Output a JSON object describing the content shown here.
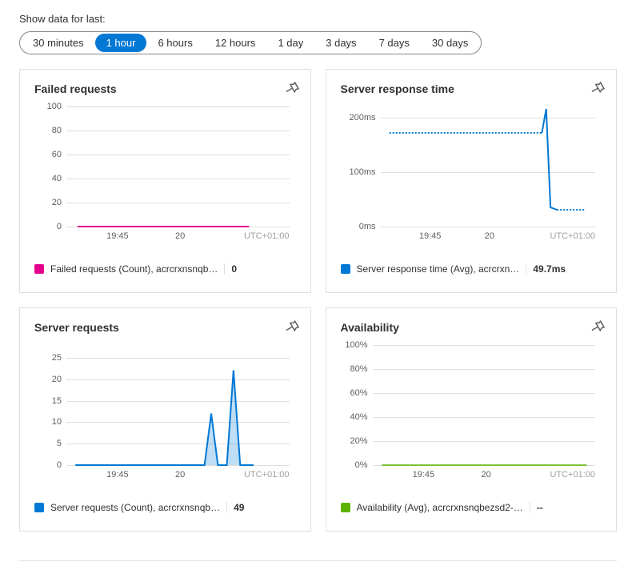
{
  "time_filter": {
    "label": "Show data for last:",
    "options": [
      "30 minutes",
      "1 hour",
      "6 hours",
      "12 hours",
      "1 day",
      "3 days",
      "7 days",
      "30 days"
    ],
    "selected": "1 hour"
  },
  "timezone": "UTC+01:00",
  "x_ticks": [
    "19:45",
    "20"
  ],
  "panels": {
    "failed_requests": {
      "title": "Failed requests",
      "legend_label": "Failed requests (Count), acrcrxnsnqb…",
      "legend_value": "0",
      "legend_color": "#e3008c",
      "y_ticks": [
        "100",
        "80",
        "60",
        "40",
        "20",
        "0"
      ]
    },
    "server_response_time": {
      "title": "Server response time",
      "legend_label": "Server response time (Avg), acrcrxn…",
      "legend_value": "49.7ms",
      "legend_color": "#0078d4",
      "y_ticks": [
        "200ms",
        "100ms",
        "0ms"
      ]
    },
    "server_requests": {
      "title": "Server requests",
      "legend_label": "Server requests (Count), acrcrxnsnqb…",
      "legend_value": "49",
      "legend_color": "#0078d4",
      "y_ticks": [
        "25",
        "20",
        "15",
        "10",
        "5",
        "0"
      ]
    },
    "availability": {
      "title": "Availability",
      "legend_label": "Availability (Avg), acrcrxnsnqbezsd2-…",
      "legend_value": "--",
      "legend_color": "#5db300",
      "y_ticks": [
        "100%",
        "80%",
        "60%",
        "40%",
        "20%",
        "0%"
      ]
    }
  },
  "chart_data": [
    {
      "type": "line",
      "title": "Failed requests",
      "ylabel": "Count",
      "x_range_minutes": 60,
      "x_ticks": [
        "19:45",
        "20"
      ],
      "ylim": [
        0,
        100
      ],
      "series": [
        {
          "name": "Failed requests (Count), acrcrxnsnqb…",
          "color": "#e3008c",
          "x": [
            0,
            5,
            10,
            15,
            20,
            25,
            30,
            35,
            40,
            45,
            50,
            55,
            60
          ],
          "values": [
            0,
            0,
            0,
            0,
            0,
            0,
            0,
            0,
            0,
            0,
            0,
            0,
            0
          ]
        }
      ],
      "legend_summary": 0
    },
    {
      "type": "line",
      "title": "Server response time",
      "ylabel": "ms",
      "x_range_minutes": 60,
      "x_ticks": [
        "19:45",
        "20"
      ],
      "ylim": [
        0,
        220
      ],
      "series": [
        {
          "name": "Server response time (Avg), acrcrxn…",
          "color": "#0078d4",
          "x": [
            0,
            5,
            10,
            15,
            20,
            25,
            30,
            35,
            40,
            45,
            47,
            48,
            50,
            55,
            60
          ],
          "values": [
            170,
            170,
            170,
            170,
            170,
            170,
            170,
            170,
            170,
            170,
            215,
            35,
            30,
            30,
            30
          ],
          "dashed_until_x": 45
        }
      ],
      "legend_summary": "49.7ms"
    },
    {
      "type": "area",
      "title": "Server requests",
      "ylabel": "Count",
      "x_range_minutes": 60,
      "x_ticks": [
        "19:45",
        "20"
      ],
      "ylim": [
        0,
        28
      ],
      "series": [
        {
          "name": "Server requests (Count), acrcrxnsnqb…",
          "color": "#0078d4",
          "x": [
            0,
            5,
            10,
            15,
            20,
            25,
            30,
            35,
            38,
            40,
            42,
            44,
            46,
            48,
            50,
            55,
            60
          ],
          "values": [
            0,
            0,
            0,
            0,
            0,
            0,
            0,
            0,
            0,
            12,
            0,
            0,
            22,
            0,
            0,
            0,
            0
          ]
        }
      ],
      "legend_summary": 49
    },
    {
      "type": "line",
      "title": "Availability",
      "ylabel": "%",
      "x_range_minutes": 60,
      "x_ticks": [
        "19:45",
        "20"
      ],
      "ylim": [
        0,
        100
      ],
      "series": [
        {
          "name": "Availability (Avg), acrcrxnsnqbezsd2-…",
          "color": "#5db300",
          "x": [
            0,
            60
          ],
          "values": [
            0,
            0
          ]
        }
      ],
      "legend_summary": "--"
    }
  ]
}
